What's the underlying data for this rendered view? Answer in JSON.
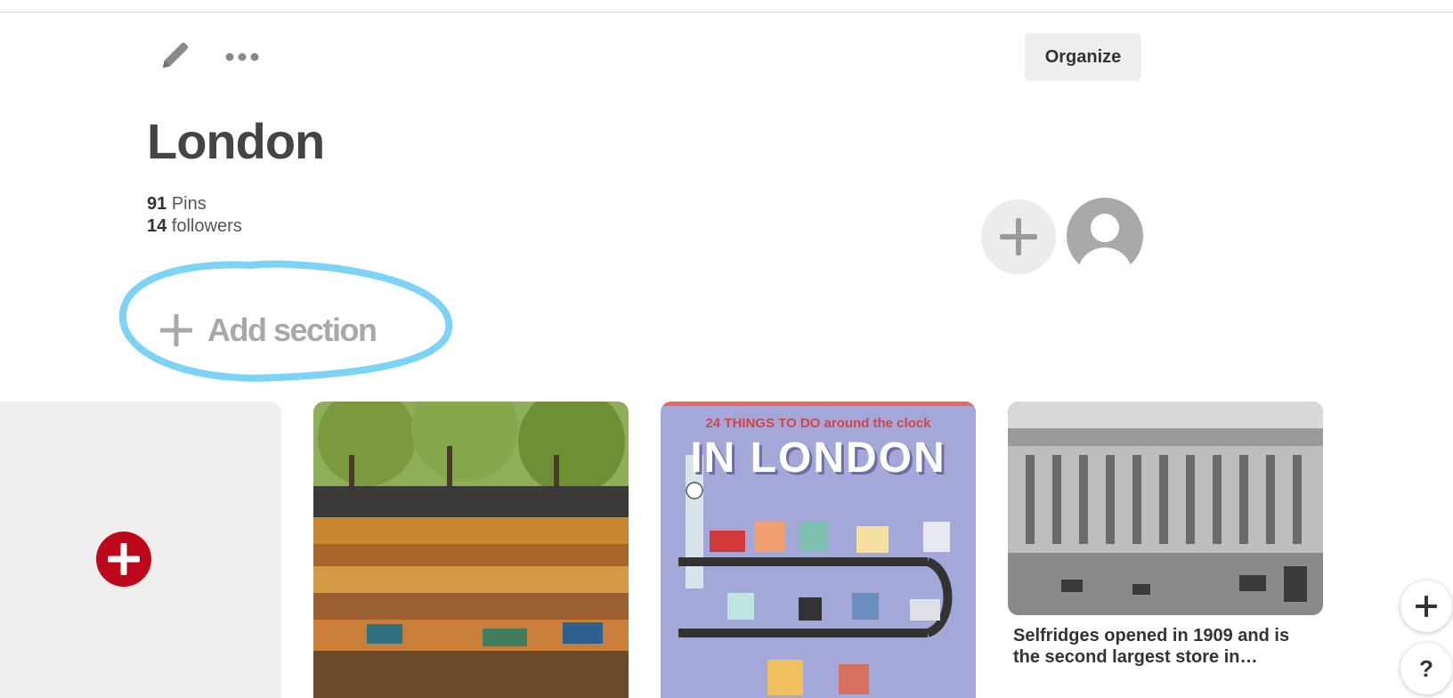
{
  "header": {
    "edit_icon": "pencil-icon",
    "more_icon": "ellipsis-icon",
    "organize_label": "Organize"
  },
  "board": {
    "title": "London",
    "pins_count": "91",
    "pins_label": "Pins",
    "followers_count": "14",
    "followers_label": "followers"
  },
  "collaborators": {
    "add_icon": "plus-icon",
    "owner_icon": "user-avatar-icon"
  },
  "sections": {
    "add_label": "Add section",
    "highlight_color": "#7dd3f5"
  },
  "pins": [
    {
      "image": "book-market-under-trees",
      "description": ""
    },
    {
      "image": "24-things-to-do-in-london-infographic",
      "image_text_top": "24 THINGS TO DO around the clock",
      "image_text_main": "IN LONDON",
      "description": ""
    },
    {
      "image": "selfridges-historic-photo",
      "description": "Selfridges opened in 1909 and is the second largest store in…"
    }
  ],
  "floating": {
    "add_icon": "plus-icon",
    "help_label": "?"
  },
  "colors": {
    "brand_red": "#bd081c",
    "button_gray": "#efefef",
    "highlight_blue": "#7dd3f5"
  }
}
